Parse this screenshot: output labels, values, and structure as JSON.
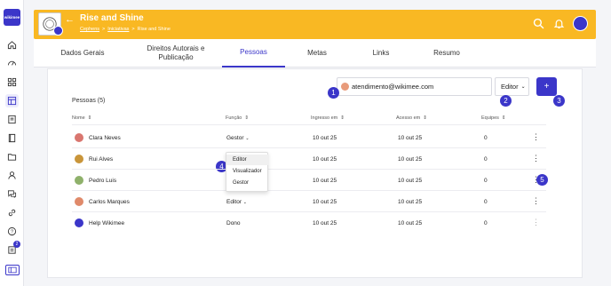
{
  "brand": {
    "logo_text": "wikimee",
    "accent": "#3b36c9",
    "header_bg": "#f9b823"
  },
  "sidebar": {
    "items": [
      {
        "icon": "home-icon"
      },
      {
        "icon": "dashboard-icon"
      },
      {
        "icon": "grid-icon"
      },
      {
        "icon": "board-icon",
        "active": true
      },
      {
        "icon": "document-icon"
      },
      {
        "icon": "book-icon"
      },
      {
        "icon": "folder-icon"
      },
      {
        "icon": "user-icon"
      },
      {
        "icon": "chat-icon"
      },
      {
        "icon": "link-icon"
      },
      {
        "icon": "help-icon"
      },
      {
        "icon": "notification-list-icon",
        "badge": "2"
      }
    ],
    "footer_icon": "panel-icon"
  },
  "header": {
    "title": "Rise and Shine",
    "breadcrumb": [
      "Cephens",
      "Iniciativas",
      "Rise and Shine"
    ],
    "breadcrumb_sep": ">",
    "icons": [
      "search-icon",
      "bell-icon",
      "avatar"
    ]
  },
  "tabs": [
    {
      "label": "Dados Gerais"
    },
    {
      "label": "Direitos Autorais e Publicação"
    },
    {
      "label": "Pessoas",
      "active": true
    },
    {
      "label": "Metas"
    },
    {
      "label": "Links"
    },
    {
      "label": "Resumo"
    }
  ],
  "people": {
    "count_label": "Pessoas (5)",
    "invite": {
      "email": "atendimento@wikimee.com",
      "role": "Editor",
      "add_label": "+"
    },
    "columns": [
      "Nome",
      "Função",
      "Ingresso em",
      "Acesso em",
      "Equipes"
    ],
    "sort_glyph": "⇕",
    "rows": [
      {
        "name": "Clara Neves",
        "role": "Gestor",
        "has_chevron": true,
        "joined": "10 out 25",
        "access": "10 out 25",
        "teams": "0",
        "avatar_color": "#d9766f"
      },
      {
        "name": "Rui Alves",
        "role": "",
        "has_chevron": false,
        "joined": "10 out 25",
        "access": "10 out 25",
        "teams": "0",
        "avatar_color": "#c9953a"
      },
      {
        "name": "Pedro Luis",
        "role": "",
        "has_chevron": false,
        "joined": "10 out 25",
        "access": "10 out 25",
        "teams": "0",
        "avatar_color": "#8fb16b"
      },
      {
        "name": "Carlos Marques",
        "role": "Editor",
        "has_chevron": true,
        "joined": "10 out 25",
        "access": "10 out 25",
        "teams": "0",
        "avatar_color": "#e08a6a"
      },
      {
        "name": "Help Wikimee",
        "role": "Dono",
        "has_chevron": false,
        "joined": "10 out 25",
        "access": "10 out 25",
        "teams": "0",
        "avatar_color": "#3b36c9"
      }
    ],
    "role_menu": {
      "options": [
        "Editor",
        "Visualizador",
        "Gestor"
      ],
      "selected": "Editor"
    }
  },
  "markers": [
    "1",
    "2",
    "3",
    "4",
    "5"
  ]
}
